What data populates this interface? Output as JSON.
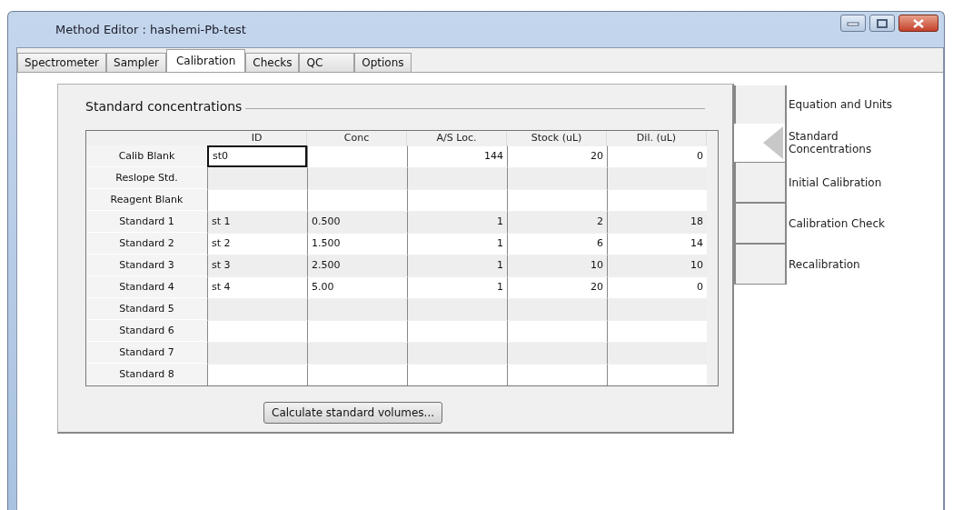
{
  "window": {
    "title": "Method Editor : hashemi-Pb-test"
  },
  "tabs": [
    {
      "label": "Spectrometer",
      "selected": false
    },
    {
      "label": "Sampler",
      "selected": false
    },
    {
      "label": "Calibration",
      "selected": true
    },
    {
      "label": "Checks",
      "selected": false
    },
    {
      "label": "QC",
      "selected": false
    },
    {
      "label": "Options",
      "selected": false
    }
  ],
  "section": {
    "title": "Standard concentrations"
  },
  "table": {
    "columns": [
      "ID",
      "Conc",
      "A/S Loc.",
      "Stock (uL)",
      "Dil. (uL)"
    ],
    "rows": [
      {
        "label": "Calib Blank",
        "selected": true,
        "cells": [
          "st0",
          "",
          "144",
          "20",
          "0"
        ]
      },
      {
        "label": "Reslope Std.",
        "selected": false,
        "cells": [
          "",
          "",
          "",
          "",
          ""
        ]
      },
      {
        "label": "Reagent Blank",
        "selected": false,
        "cells": [
          "",
          "",
          "",
          "",
          ""
        ]
      },
      {
        "label": "Standard 1",
        "selected": false,
        "cells": [
          "st 1",
          "0.500",
          "1",
          "2",
          "18"
        ]
      },
      {
        "label": "Standard 2",
        "selected": false,
        "cells": [
          "st 2",
          "1.500",
          "1",
          "6",
          "14"
        ]
      },
      {
        "label": "Standard 3",
        "selected": false,
        "cells": [
          "st 3",
          "2.500",
          "1",
          "10",
          "10"
        ]
      },
      {
        "label": "Standard 4",
        "selected": false,
        "cells": [
          "st 4",
          "5.00",
          "1",
          "20",
          "0"
        ]
      },
      {
        "label": "Standard 5",
        "selected": false,
        "cells": [
          "",
          "",
          "",
          "",
          ""
        ]
      },
      {
        "label": "Standard 6",
        "selected": false,
        "cells": [
          "",
          "",
          "",
          "",
          ""
        ]
      },
      {
        "label": "Standard 7",
        "selected": false,
        "cells": [
          "",
          "",
          "",
          "",
          ""
        ]
      },
      {
        "label": "Standard 8",
        "selected": false,
        "cells": [
          "",
          "",
          "",
          "",
          ""
        ]
      }
    ]
  },
  "button": "Calculate standard volumes...",
  "side_nav": [
    {
      "label": "Equation and Units",
      "selected": false
    },
    {
      "label": "Standard Concentrations",
      "selected": true
    },
    {
      "label": "Initial Calibration",
      "selected": false
    },
    {
      "label": "Calibration Check",
      "selected": false
    },
    {
      "label": "Recalibration",
      "selected": false
    }
  ]
}
